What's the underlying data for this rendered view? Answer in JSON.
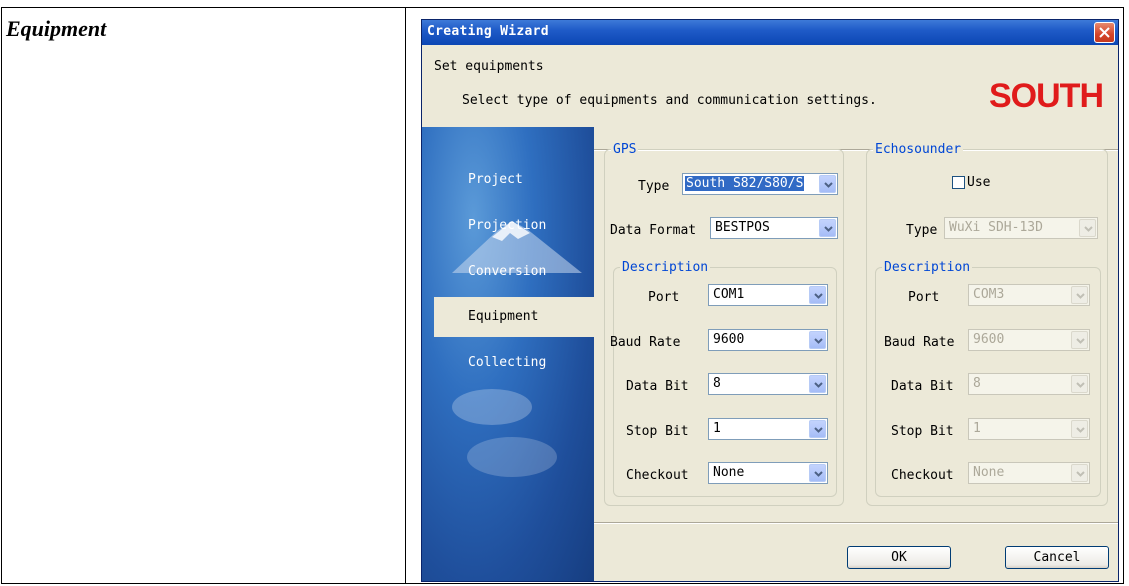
{
  "document": {
    "heading": "Equipment"
  },
  "wizard": {
    "title": "Creating Wizard",
    "header_title": "Set equipments",
    "header_subtitle": "Select type of equipments and communication settings.",
    "brand": "SOUTH",
    "nav": [
      "Project",
      "Projection",
      "Conversion",
      "Equipment",
      "Collecting"
    ],
    "active_nav": "Equipment",
    "gps": {
      "legend": "GPS",
      "type_label": "Type",
      "type_value": "South S82/S80/S",
      "format_label": "Data Format",
      "format_value": "BESTPOS",
      "desc_legend": "Description",
      "port_label": "Port",
      "port_value": "COM1",
      "baud_label": "Baud Rate",
      "baud_value": "9600",
      "databit_label": "Data Bit",
      "databit_value": "8",
      "stopbit_label": "Stop Bit",
      "stopbit_value": "1",
      "checkout_label": "Checkout",
      "checkout_value": "None"
    },
    "echo": {
      "legend": "Echosounder",
      "use_label": "Use",
      "type_label": "Type",
      "type_value": "WuXi SDH-13D",
      "desc_legend": "Description",
      "port_label": "Port",
      "port_value": "COM3",
      "baud_label": "Baud Rate",
      "baud_value": "9600",
      "databit_label": "Data Bit",
      "databit_value": "8",
      "stopbit_label": "Stop Bit",
      "stopbit_value": "1",
      "checkout_label": "Checkout",
      "checkout_value": "None"
    },
    "ok_label": "OK",
    "cancel_label": "Cancel"
  },
  "colors": {
    "titlebar": "#0b46b4",
    "legend": "#0046d5",
    "brand": "#e01b1b",
    "nav_bg": "#2f6fc0"
  },
  "icons": {
    "close": "close-icon",
    "dropdown": "chevron-down-icon"
  }
}
